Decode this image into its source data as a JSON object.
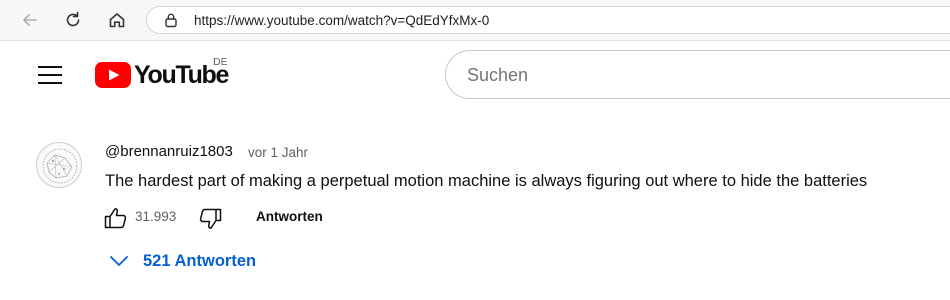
{
  "browser": {
    "url": "https://www.youtube.com/watch?v=QdEdYfxMx-0"
  },
  "header": {
    "logo_text": "YouTube",
    "region": "DE",
    "search_placeholder": "Suchen"
  },
  "comment": {
    "author": "@brennanruiz1803",
    "time": "vor 1 Jahr",
    "text": "The hardest part of making a perpetual motion machine is always figuring out where to hide the batteries",
    "likes": "31.993",
    "reply_label": "Antworten",
    "replies_label": "521 Antworten"
  },
  "colors": {
    "brand_red": "#ff0000",
    "link_blue": "#065fd4",
    "secondary_text": "#606060"
  }
}
